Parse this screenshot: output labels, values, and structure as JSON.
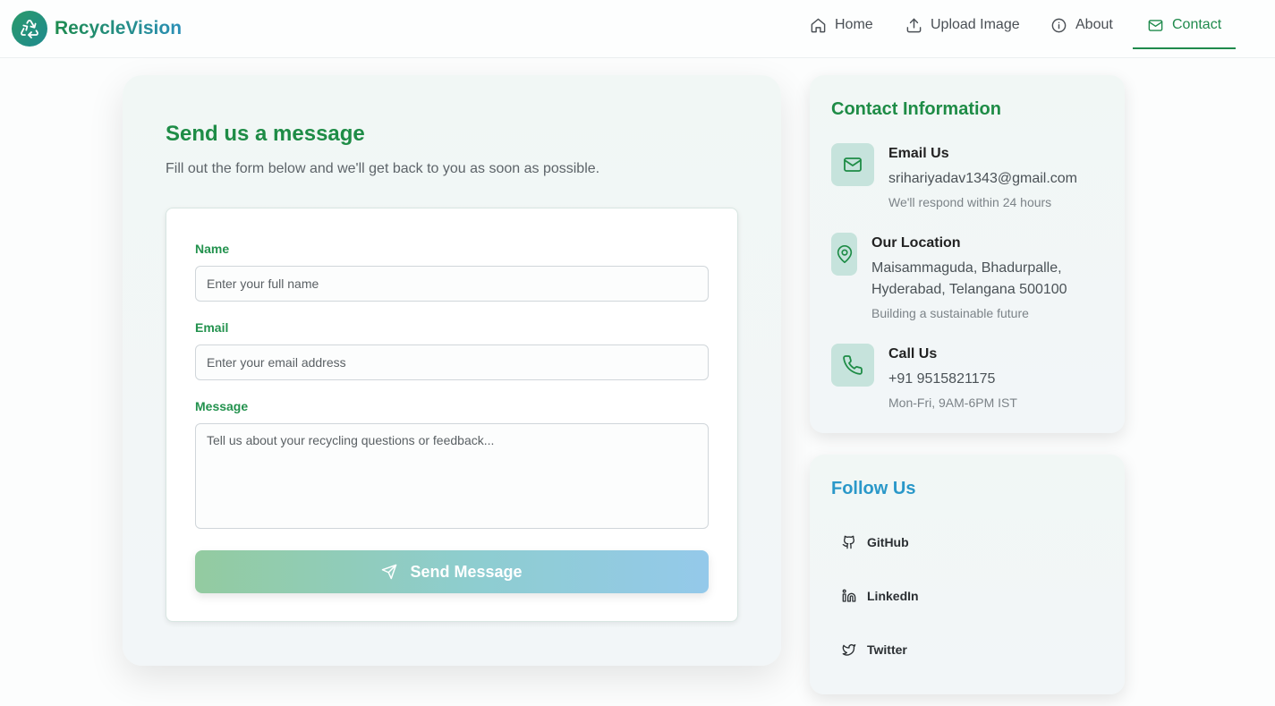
{
  "brand": {
    "name": "RecycleVision",
    "logo_icon": "recycle-icon"
  },
  "nav": {
    "items": [
      {
        "label": "Home",
        "icon": "home-icon"
      },
      {
        "label": "Upload Image",
        "icon": "upload-icon"
      },
      {
        "label": "About",
        "icon": "info-icon"
      },
      {
        "label": "Contact",
        "icon": "mail-icon",
        "active": true
      }
    ]
  },
  "form": {
    "title": "Send us a message",
    "subtitle": "Fill out the form below and we'll get back to you as soon as possible.",
    "name_label": "Name",
    "name_placeholder": "Enter your full name",
    "email_label": "Email",
    "email_placeholder": "Enter your email address",
    "message_label": "Message",
    "message_placeholder": "Tell us about your recycling questions or feedback...",
    "submit_label": "Send Message"
  },
  "contact_info": {
    "title": "Contact Information",
    "email": {
      "heading": "Email Us",
      "value": "srihariyadav1343@gmail.com",
      "note": "We'll respond within 24 hours"
    },
    "location": {
      "heading": "Our Location",
      "line1": "Maisammaguda, Bhadurpalle,",
      "line2": "Hyderabad, Telangana 500100",
      "note": "Building a sustainable future"
    },
    "phone": {
      "heading": "Call Us",
      "value": "+91 9515821175",
      "note": "Mon-Fri, 9AM-6PM IST"
    }
  },
  "follow": {
    "title": "Follow Us",
    "links": [
      {
        "label": "GitHub",
        "icon": "github-icon"
      },
      {
        "label": "LinkedIn",
        "icon": "linkedin-icon"
      },
      {
        "label": "Twitter",
        "icon": "twitter-icon"
      }
    ]
  },
  "colors": {
    "brand_green": "#1e8c46",
    "accent_blue": "#2a98c9",
    "icon_bg": "#c6e3dc"
  }
}
